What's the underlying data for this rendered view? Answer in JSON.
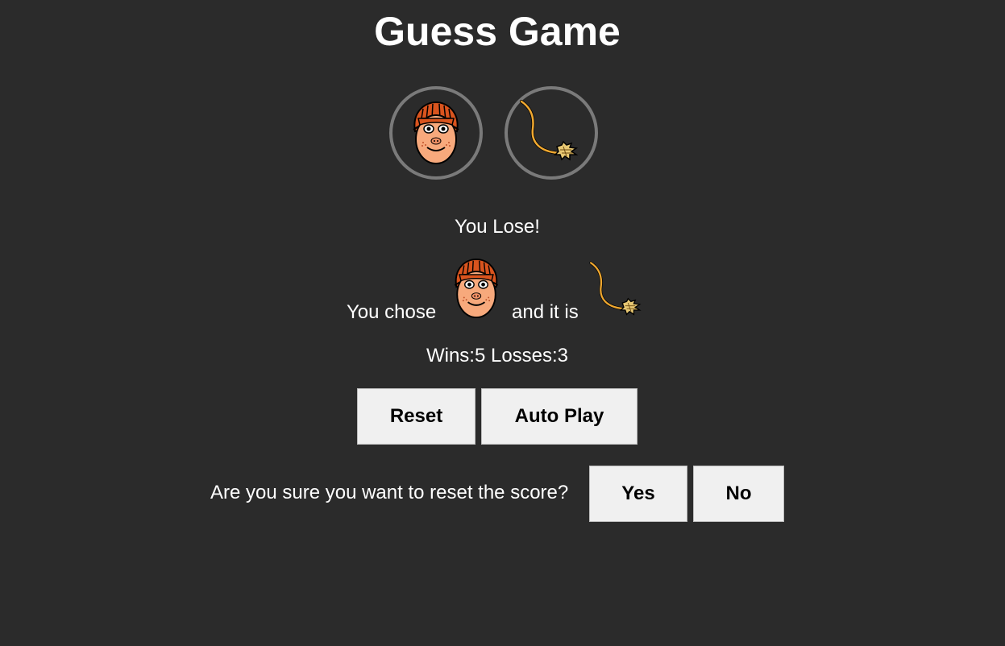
{
  "title": "Guess Game",
  "choices": [
    {
      "icon": "scarecrow-face-icon"
    },
    {
      "icon": "broom-icon"
    }
  ],
  "result": "You Lose!",
  "moves": {
    "prefix": "You chose",
    "middle": "and it is",
    "player_icon": "scarecrow-face-icon",
    "computer_icon": "broom-icon"
  },
  "score": {
    "text": "Wins:5 Losses:3",
    "wins": 5,
    "losses": 3
  },
  "buttons": {
    "reset": "Reset",
    "auto_play": "Auto Play"
  },
  "confirm": {
    "question": "Are you sure you want to reset the score?",
    "yes": "Yes",
    "no": "No"
  },
  "colors": {
    "background": "#2b2b2b",
    "ring": "#7a7a7a",
    "button": "#f0f0f0",
    "face": "#f7a97c",
    "hair": "#d9541e",
    "broom_handle": "#f0a830"
  }
}
